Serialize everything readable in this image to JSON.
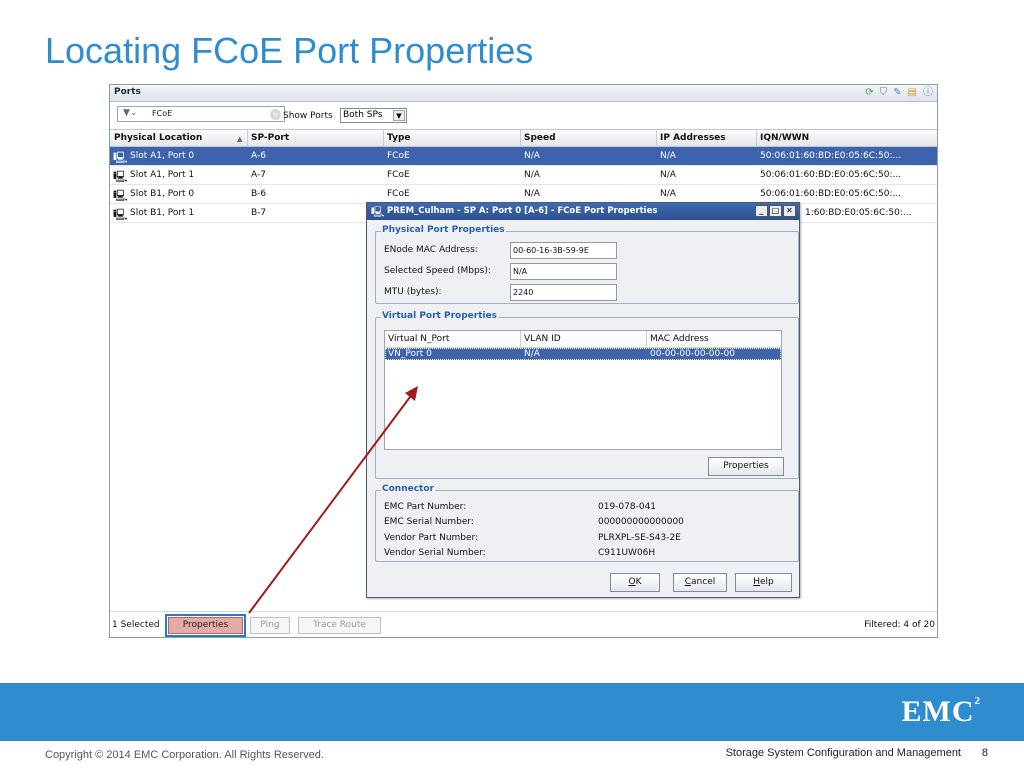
{
  "slide": {
    "title": "Locating FCoE Port Properties",
    "copyright": "Copyright © 2014 EMC Corporation. All Rights Reserved.",
    "course": "Storage System Configuration and Management",
    "page_number": "8",
    "logo_text": "EMC",
    "logo_superscript": "2",
    "accent_color": "#2f8dcf"
  },
  "ports_panel": {
    "title": "Ports",
    "header_icons": [
      "refresh-icon",
      "filter-icon",
      "tools-icon",
      "export-icon",
      "help-icon"
    ],
    "filter": {
      "value": "FCoE",
      "icon": "funnel-icon"
    },
    "show_ports_label": "Show Ports",
    "sp_select": {
      "value": "Both SPs"
    },
    "columns": [
      "Physical Location",
      "SP-Port",
      "Type",
      "Speed",
      "IP Addresses",
      "IQN/WWN"
    ],
    "rows": [
      {
        "location": "Slot A1, Port 0",
        "sp_port": "A-6",
        "type": "FCoE",
        "speed": "N/A",
        "ip": "N/A",
        "iqn": "50:06:01:60:BD:E0:05:6C:50:...",
        "selected": true
      },
      {
        "location": "Slot A1, Port 1",
        "sp_port": "A-7",
        "type": "FCoE",
        "speed": "N/A",
        "ip": "N/A",
        "iqn": "50:06:01:60:BD:E0:05:6C:50:...",
        "selected": false
      },
      {
        "location": "Slot B1, Port 0",
        "sp_port": "B-6",
        "type": "FCoE",
        "speed": "N/A",
        "ip": "N/A",
        "iqn": "50:06:01:60:BD:E0:05:6C:50:...",
        "selected": false
      },
      {
        "location": "Slot B1, Port 1",
        "sp_port": "B-7",
        "type": "",
        "speed": "",
        "ip": "",
        "iqn": "1:60:BD:E0:05:6C:50:...",
        "selected": false
      }
    ],
    "selected_count": "1 Selected",
    "buttons": {
      "properties": "Properties",
      "ping": "Ping",
      "trace_route": "Trace Route"
    },
    "filtered": "Filtered: 4 of 20"
  },
  "dialog": {
    "title": "PREM_Culham - SP A: Port 0 [A-6] - FCoE Port Properties",
    "physical": {
      "legend": "Physical Port Properties",
      "enode_mac_label": "ENode MAC Address:",
      "enode_mac_value": "00-60-16-3B-59-9E",
      "speed_label": "Selected Speed (Mbps):",
      "speed_value": "N/A",
      "mtu_label": "MTU (bytes):",
      "mtu_value": "2240"
    },
    "virtual": {
      "legend": "Virtual Port Properties",
      "columns": [
        "Virtual N_Port",
        "VLAN ID",
        "MAC Address"
      ],
      "rows": [
        {
          "nport": "VN_Port 0",
          "vlan": "N/A",
          "mac": "00-00-00-00-00-00"
        }
      ],
      "properties_button": "Properties"
    },
    "connector": {
      "legend": "Connector",
      "fields": [
        {
          "label": "EMC Part Number:",
          "value": "019-078-041"
        },
        {
          "label": "EMC Serial Number:",
          "value": "000000000000000"
        },
        {
          "label": "Vendor Part Number:",
          "value": "PLRXPL-SE-S43-2E"
        },
        {
          "label": "Vendor Serial Number:",
          "value": "C911UW06H"
        }
      ]
    },
    "buttons": {
      "ok": "OK",
      "cancel": "Cancel",
      "help": "Help"
    }
  }
}
